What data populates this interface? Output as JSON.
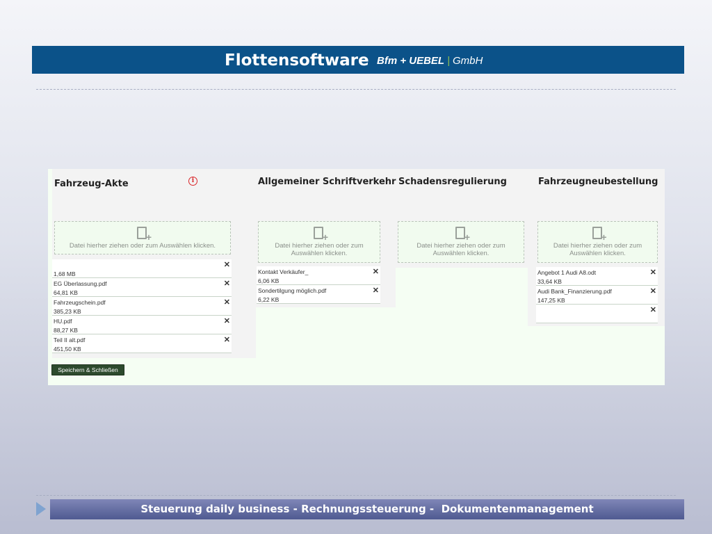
{
  "header": {
    "title": "Flottensoftware",
    "company_bold": "Bfm + UEBEL",
    "company_sep": "|",
    "company_rest": "GmbH"
  },
  "columns": [
    {
      "title": "Fahrzeug-Akte",
      "has_info_icon": true,
      "dropzone_text": "Datei hierher ziehen oder zum Auswählen klicken.",
      "files": [
        {
          "name": "",
          "size": "1,68 MB"
        },
        {
          "name": "EG Überlassung.pdf",
          "size": "64,81 KB"
        },
        {
          "name": "Fahrzeugschein.pdf",
          "size": "385,23 KB"
        },
        {
          "name": "HU.pdf",
          "size": "88,27 KB"
        },
        {
          "name": "Teil II alt.pdf",
          "size": "451,50 KB"
        }
      ]
    },
    {
      "title": "Allgemeiner Schriftverkehr",
      "dropzone_text": "Datei hierher ziehen oder zum Auswählen klicken.",
      "files": [
        {
          "name": "Kontakt Verkäufer_",
          "size": "6,06 KB"
        },
        {
          "name": "Sondertilgung möglich.pdf",
          "size": "6,22 KB"
        }
      ]
    },
    {
      "title": "Schadensregulierung",
      "dropzone_text": "Datei hierher ziehen oder zum Auswählen klicken.",
      "files": []
    },
    {
      "title": "Fahrzeugneubestellung",
      "dropzone_text": "Datei hierher ziehen oder zum Auswählen klicken.",
      "files": [
        {
          "name": "Angebot 1 Audi A8.odt",
          "size": "33,64 KB"
        },
        {
          "name": "Audi Bank_Finanzierung.pdf",
          "size": "147,25 KB"
        },
        {
          "name": "",
          "size": ""
        }
      ]
    }
  ],
  "close_glyph": "✕",
  "save_button": "Speichern & Schließen",
  "footer": "Steuerung daily business - Rechnungssteuerung -  Dokumentenmanagement"
}
